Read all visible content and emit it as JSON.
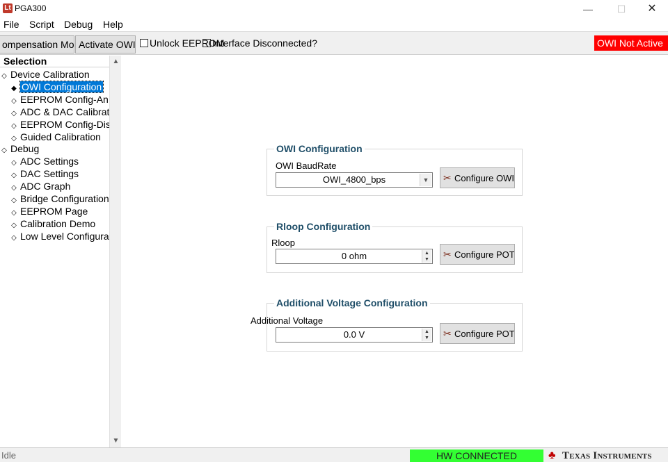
{
  "window": {
    "title": "PGA300",
    "icon_letter": "Lt",
    "controls": {
      "minimize": "—",
      "maximize": "☐",
      "close": "✕"
    }
  },
  "menu": [
    "File",
    "Script",
    "Debug",
    "Help"
  ],
  "toolbar": {
    "compensation_label": "ompensation Mod",
    "activate_label": "Activate OWI",
    "unlock_label": "Unlock EEPROM",
    "interface_label": "Interface Disconnected?",
    "owi_status": "OWI  Not Active",
    "owi_status_color": "#ff0000"
  },
  "sidebar": {
    "header": "Selection",
    "tree": [
      {
        "label": "Device Calibration",
        "level": 0,
        "selected": false
      },
      {
        "label": "OWI Configuration",
        "level": 1,
        "selected": true
      },
      {
        "label": "EEPROM Config-An",
        "level": 1,
        "selected": false
      },
      {
        "label": "ADC & DAC Calibrati",
        "level": 1,
        "selected": false
      },
      {
        "label": "EEPROM Config-Dis",
        "level": 1,
        "selected": false
      },
      {
        "label": "Guided Calibration",
        "level": 1,
        "selected": false
      },
      {
        "label": "Debug",
        "level": 0,
        "selected": false
      },
      {
        "label": "ADC Settings",
        "level": 1,
        "selected": false
      },
      {
        "label": "DAC Settings",
        "level": 1,
        "selected": false
      },
      {
        "label": "ADC Graph",
        "level": 1,
        "selected": false
      },
      {
        "label": "Bridge Configuration",
        "level": 1,
        "selected": false
      },
      {
        "label": "EEPROM Page",
        "level": 1,
        "selected": false
      },
      {
        "label": "Calibration Demo",
        "level": 1,
        "selected": false
      },
      {
        "label": "Low Level Configura",
        "level": 1,
        "selected": false
      }
    ],
    "scroll_up": "▲",
    "scroll_down": "▼"
  },
  "owi_group": {
    "title": "OWI Configuration",
    "field_label": "OWI BaudRate",
    "value": "OWI_4800_bps",
    "button": "Configure OWI"
  },
  "rloop_group": {
    "title": "Rloop Configuration",
    "field_label": "Rloop",
    "value": "0 ohm",
    "button": "Configure POT"
  },
  "voltage_group": {
    "title": "Additional Voltage Configuration",
    "field_label": "Additional Voltage",
    "value": "0.0 V",
    "button": "Configure POT"
  },
  "statusbar": {
    "status": "Idle",
    "hw_status": "HW CONNECTED",
    "hw_status_color": "#33ff33",
    "brand": "Texas Instruments"
  }
}
